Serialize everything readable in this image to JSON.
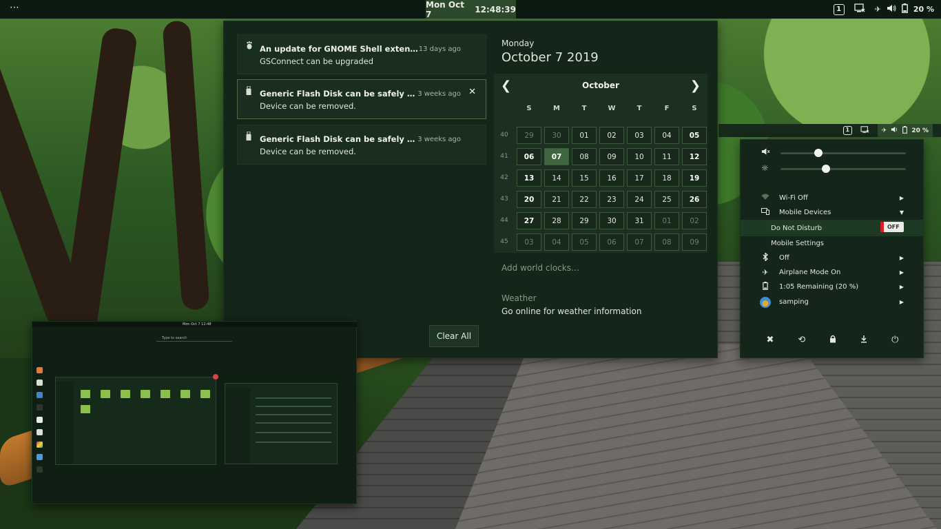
{
  "topbar": {
    "activities": "⋯",
    "clock_date": "Mon Oct 7",
    "clock_time": "12:48:39",
    "workspace": "1",
    "battery": "20 %"
  },
  "notifications": [
    {
      "icon": "gnome-foot-icon",
      "title": "An update for GNOME Shell extensions a...",
      "body": "GSConnect can be upgraded",
      "time": "13 days ago"
    },
    {
      "icon": "usb-icon",
      "title": "Generic Flash Disk can be safely unplug...",
      "body": "Device can be removed.",
      "time": "3 weeks ago",
      "close": "✕"
    },
    {
      "icon": "usb-icon",
      "title": "Generic Flash Disk can be safely unplug...",
      "body": "Device can be removed.",
      "time": "3 weeks ago"
    }
  ],
  "clear_all": "Clear All",
  "date_header": {
    "day": "Monday",
    "full": "October  7 2019"
  },
  "calendar": {
    "month": "October",
    "prev": "❮",
    "next": "❯",
    "weekdays": [
      "S",
      "M",
      "T",
      "W",
      "T",
      "F",
      "S"
    ],
    "weeks": [
      {
        "num": "40",
        "days": [
          "29",
          "30",
          "01",
          "02",
          "03",
          "04",
          "05"
        ]
      },
      {
        "num": "41",
        "days": [
          "06",
          "07",
          "08",
          "09",
          "10",
          "11",
          "12"
        ]
      },
      {
        "num": "42",
        "days": [
          "13",
          "14",
          "15",
          "16",
          "17",
          "18",
          "19"
        ]
      },
      {
        "num": "43",
        "days": [
          "20",
          "21",
          "22",
          "23",
          "24",
          "25",
          "26"
        ]
      },
      {
        "num": "44",
        "days": [
          "27",
          "28",
          "29",
          "30",
          "31",
          "01",
          "02"
        ]
      },
      {
        "num": "45",
        "days": [
          "03",
          "04",
          "05",
          "06",
          "07",
          "08",
          "09"
        ]
      }
    ],
    "today": "07"
  },
  "world_clocks": "Add world clocks…",
  "weather": {
    "heading": "Weather",
    "text": "Go online for weather information"
  },
  "strip2": {
    "workspace": "1",
    "battery": "20 %"
  },
  "system_menu": {
    "volume_level": 0.3,
    "brightness_level": 0.36,
    "items": {
      "wifi": "Wi-Fi Off",
      "mobile_devices": "Mobile Devices",
      "dnd": "Do Not Disturb",
      "dnd_toggle": "OFF",
      "mobile_settings": "Mobile Settings",
      "bluetooth": "Off",
      "airplane": "Airplane Mode On",
      "battery": "1:05 Remaining (20 %)",
      "user": "samping"
    }
  },
  "thumbnail": {
    "clock": "Mon Oct 7 12:48",
    "search": "Type to search"
  },
  "colors": {
    "panel_bg": "#142519",
    "accent": "#3f6641",
    "toggle_off": "#d51f25"
  }
}
